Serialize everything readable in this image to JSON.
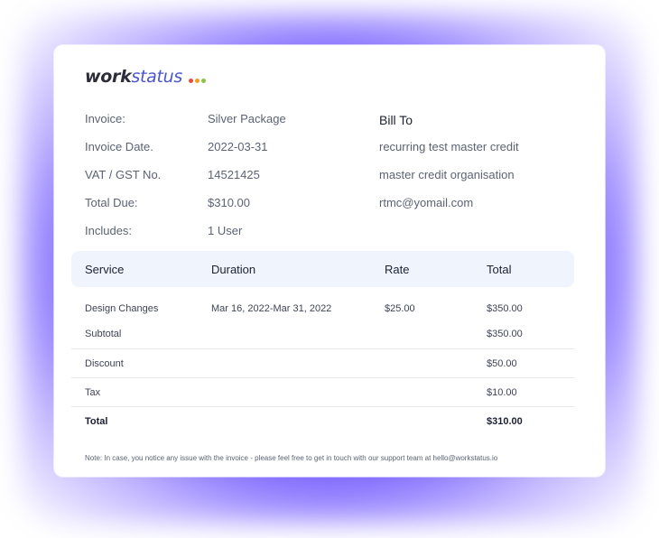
{
  "logo": {
    "word1": "work",
    "word2": "status",
    "dot_colors": [
      "#e74c3c",
      "#f0a020",
      "#8bc34a"
    ]
  },
  "invoice": {
    "labels": [
      "Invoice:",
      "Invoice Date.",
      "VAT / GST No.",
      "Total Due:",
      "Includes:"
    ],
    "values": [
      "Silver Package",
      "2022-03-31",
      "14521425",
      "$310.00",
      "1 User"
    ]
  },
  "bill_to": {
    "title": "Bill To",
    "lines": [
      "recurring test master credit",
      "master credit organisation",
      "rtmc@yomail.com"
    ]
  },
  "table": {
    "headers": [
      "Service",
      "Duration",
      "Rate",
      "Total"
    ],
    "rows": [
      {
        "service": "Design Changes",
        "duration": "Mar 16, 2022-Mar 31, 2022",
        "rate": "$25.00",
        "total": "$350.00"
      }
    ],
    "summary": [
      {
        "label": "Subtotal",
        "value": "$350.00"
      },
      {
        "label": "Discount",
        "value": "$50.00"
      },
      {
        "label": "Tax",
        "value": "$10.00"
      },
      {
        "label": "Total",
        "value": "$310.00"
      }
    ]
  },
  "note": "Note: In case, you notice any issue with the invoice - please feel free to get in touch with our support team at hello@workstatus.io"
}
